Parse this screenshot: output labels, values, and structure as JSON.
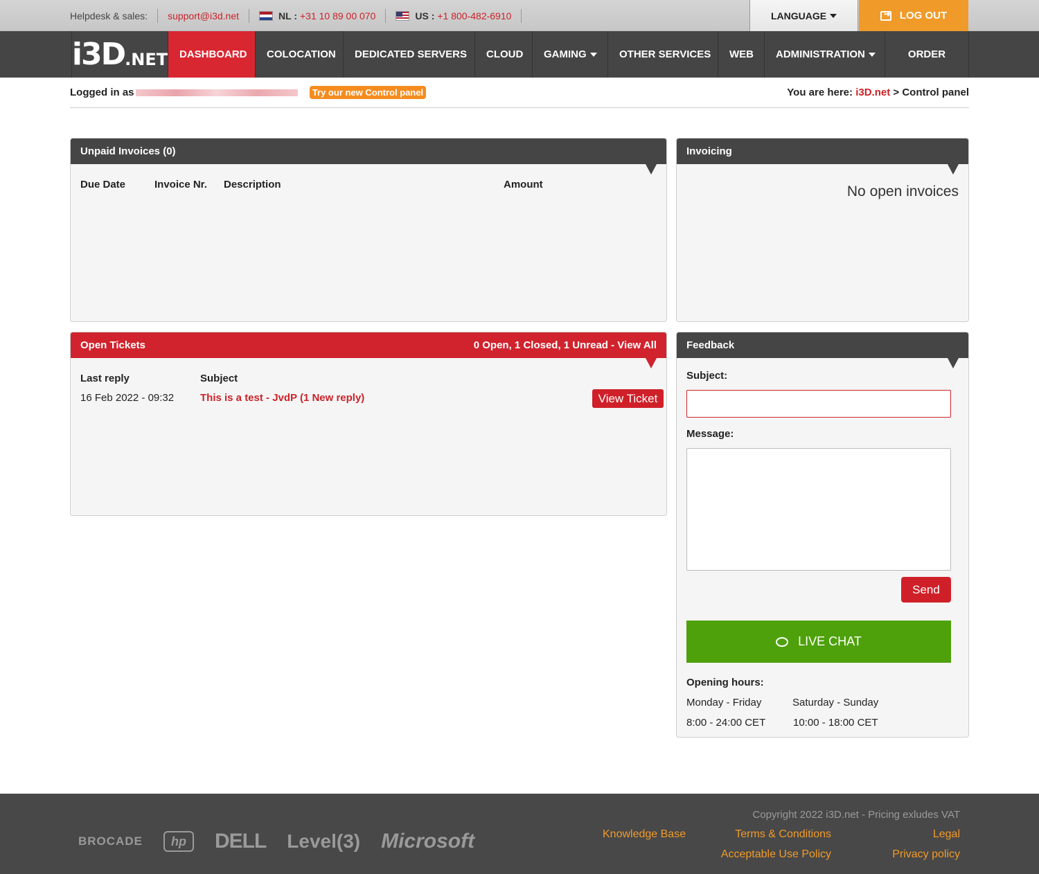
{
  "topbar": {
    "helpdesk_label": "Helpdesk & sales:",
    "email": "support@i3d.net",
    "nl_label": "NL :",
    "nl_phone": "+31 10 89 00 070",
    "us_label": "US :",
    "us_phone": "+1 800-482-6910",
    "language_label": "LANGUAGE",
    "logout_label": "LOG OUT"
  },
  "nav": {
    "logo_main": "i3D",
    "logo_suffix": ".NET",
    "items": [
      {
        "label": "DASHBOARD",
        "active": true
      },
      {
        "label": "COLOCATION"
      },
      {
        "label": "DEDICATED SERVERS"
      },
      {
        "label": "CLOUD"
      },
      {
        "label": "GAMING",
        "dropdown": true
      },
      {
        "label": "OTHER SERVICES"
      },
      {
        "label": "WEB"
      },
      {
        "label": "ADMINISTRATION",
        "dropdown": true
      },
      {
        "label": "ORDER"
      }
    ]
  },
  "status": {
    "logged_in_label": "Logged in as",
    "try_label": "Try our new Control panel",
    "crumb_prefix": "You are here:",
    "crumb_home": "i3D.net",
    "crumb_sep": ">",
    "crumb_current": "Control panel"
  },
  "unpaid": {
    "title": "Unpaid Invoices (0)",
    "columns": [
      "Due Date",
      "Invoice Nr.",
      "Description",
      "Amount"
    ]
  },
  "invoicing": {
    "title": "Invoicing",
    "empty_text": "No open invoices"
  },
  "tickets": {
    "title": "Open Tickets",
    "summary": "0 Open, 1 Closed, 1 Unread - View All",
    "col_last_reply": "Last reply",
    "col_subject": "Subject",
    "rows": [
      {
        "date": "16 Feb 2022 - 09:32",
        "subject": "This is a test - JvdP (1 New reply)",
        "action": "View Ticket"
      }
    ]
  },
  "feedback": {
    "title": "Feedback",
    "subject_label": "Subject:",
    "subject_value": "",
    "message_label": "Message:",
    "message_value": "",
    "send_label": "Send",
    "livechat_label": "LIVE CHAT",
    "hours_label": "Opening hours:",
    "weekday_label": "Monday - Friday",
    "weekday_hours": "8:00 - 24:00 CET",
    "weekend_label": "Saturday - Sunday",
    "weekend_hours": "10:00 - 18:00 CET"
  },
  "footer": {
    "brands": [
      "BROCADE",
      "hp",
      "DELL",
      "Level(3)",
      "Microsoft"
    ],
    "copyright": "Copyright 2022 i3D.net - Pricing exludes VAT",
    "links": {
      "knowledge_base": "Knowledge Base",
      "terms": "Terms & Conditions",
      "legal": "Legal",
      "aup": "Acceptable Use Policy",
      "privacy": "Privacy policy"
    }
  },
  "colors": {
    "accent_red": "#d0232d",
    "nav_bg": "#454545",
    "orange": "#f09a2a",
    "live_chat_green": "#4ea10a"
  }
}
